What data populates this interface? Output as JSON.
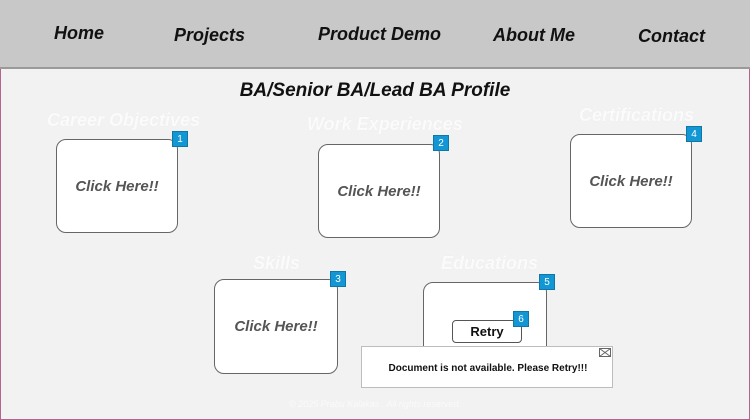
{
  "nav": {
    "items": [
      {
        "label": "Home"
      },
      {
        "label": "Projects"
      },
      {
        "label": "Product Demo"
      },
      {
        "label": "About Me"
      },
      {
        "label": "Contact"
      }
    ]
  },
  "page": {
    "title": "BA/Senior BA/Lead BA Profile"
  },
  "sections": [
    {
      "label": "Career Objectives",
      "card_text": "Click Here!!",
      "badge": "1"
    },
    {
      "label": "Work Experiences",
      "card_text": "Click Here!!",
      "badge": "2"
    },
    {
      "label": "Certifications",
      "card_text": "Click Here!!",
      "badge": "4"
    },
    {
      "label": "Skills",
      "card_text": "Click Here!!",
      "badge": "3"
    },
    {
      "label": "Educations",
      "badge": "5"
    }
  ],
  "retry": {
    "label": "Retry",
    "badge": "6"
  },
  "dialog": {
    "message": "Document is not available. Please Retry!!!"
  },
  "footer": {
    "text": "© 2025 Prabu Kalakas . All rights reserved."
  },
  "colors": {
    "nav_bg": "#c8c8c8",
    "page_bg": "#f2f2f2",
    "badge": "#1296d4",
    "frame_border": "#b5638f"
  }
}
